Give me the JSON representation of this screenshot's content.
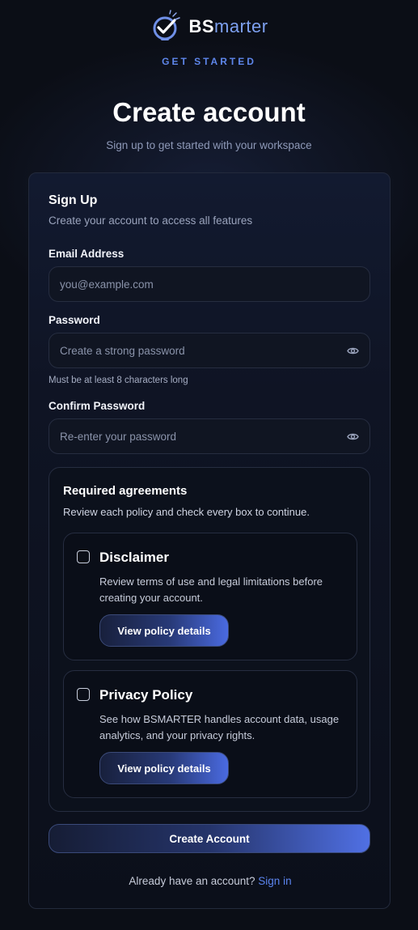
{
  "brand": {
    "name_bold": "BS",
    "name_rest": "marter",
    "tagline": "GET STARTED",
    "accent": "#5e86ea"
  },
  "header": {
    "title": "Create account",
    "subtitle": "Sign up to get started with your workspace"
  },
  "card": {
    "title": "Sign Up",
    "subtitle": "Create your account to access all features"
  },
  "form": {
    "email": {
      "label": "Email Address",
      "placeholder": "you@example.com",
      "value": ""
    },
    "password": {
      "label": "Password",
      "placeholder": "Create a strong password",
      "value": "",
      "hint": "Must be at least 8 characters long",
      "toggle_icon": "eye-icon"
    },
    "confirm": {
      "label": "Confirm Password",
      "placeholder": "Re-enter your password",
      "value": "",
      "toggle_icon": "eye-icon"
    }
  },
  "agreements": {
    "title": "Required agreements",
    "subtitle": "Review each policy and check every box to continue.",
    "items": [
      {
        "title": "Disclaimer",
        "description": "Review terms of use and legal limitations before creating your account.",
        "button": "View policy details",
        "checked": false
      },
      {
        "title": "Privacy Policy",
        "description": "See how BSMARTER handles account data, usage analytics, and your privacy rights.",
        "button": "View policy details",
        "checked": false
      }
    ]
  },
  "submit_label": "Create Account",
  "footer": {
    "prompt": "Already have an account?",
    "link": "Sign in",
    "link_color": "#5b84ee"
  }
}
